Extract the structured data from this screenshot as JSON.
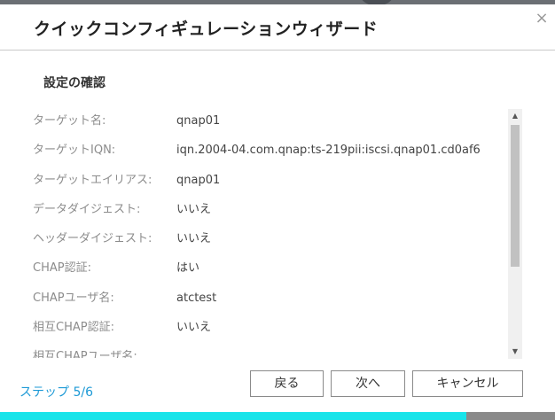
{
  "dialog": {
    "title": "クイックコンフィギュレーションウィザード",
    "close_glyph": "×"
  },
  "section": {
    "title": "設定の確認"
  },
  "summary": {
    "rows": [
      {
        "label": "ターゲット名:",
        "value": "qnap01"
      },
      {
        "label": "ターゲットIQN:",
        "value": "iqn.2004-04.com.qnap:ts-219pii:iscsi.qnap01.cd0af6"
      },
      {
        "label": "ターゲットエイリアス:",
        "value": "qnap01"
      },
      {
        "label": "データダイジェスト:",
        "value": "いいえ"
      },
      {
        "label": "ヘッダーダイジェスト:",
        "value": "いいえ"
      },
      {
        "label": "CHAP認証:",
        "value": "はい"
      },
      {
        "label": "CHAPユーザ名:",
        "value": "atctest"
      },
      {
        "label": "相互CHAP認証:",
        "value": "いいえ"
      },
      {
        "label": "相互CHAPユーザ名:",
        "value": ""
      }
    ]
  },
  "scrollbar": {
    "up_glyph": "▲",
    "down_glyph": "▼"
  },
  "footer": {
    "step_label": "ステップ 5/6",
    "back_label": "戻る",
    "next_label": "次へ",
    "cancel_label": "キャンセル"
  },
  "progress": {
    "fraction": 0.84
  },
  "colors": {
    "accent": "#1e9ad6",
    "progress_fill": "#18e4ea",
    "progress_track": "#8a8a8a"
  }
}
